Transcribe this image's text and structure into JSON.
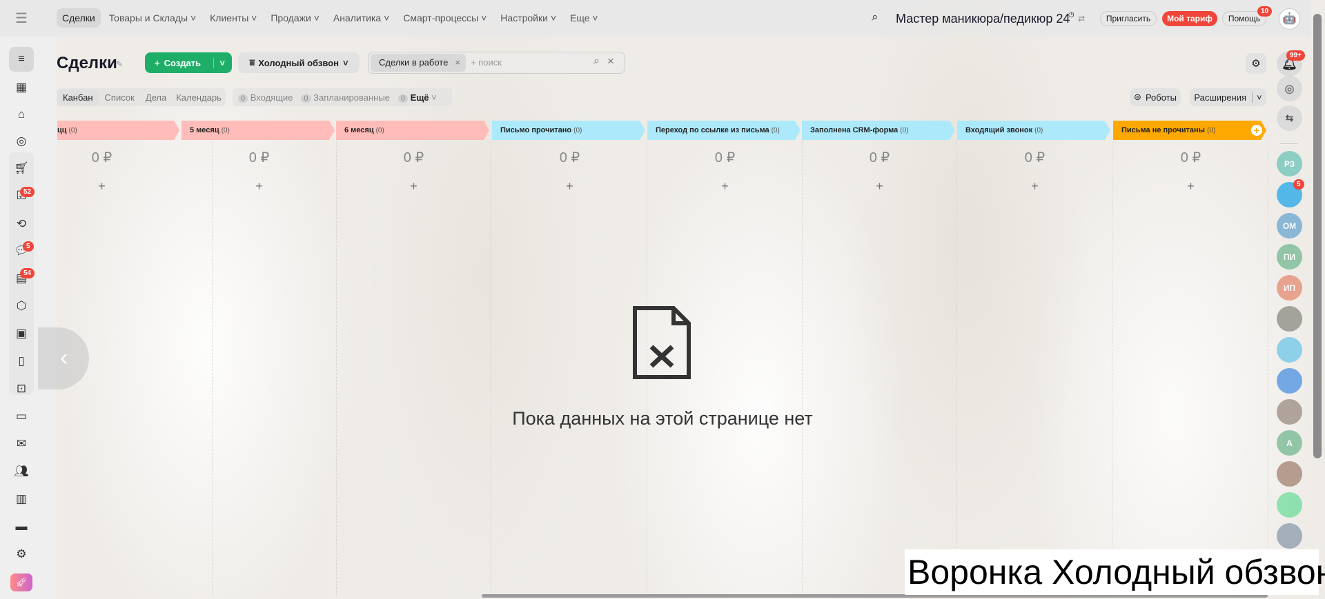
{
  "nav": {
    "items": [
      "Сделки",
      "Товары и Склады",
      "Клиенты",
      "Продажи",
      "Аналитика",
      "Смарт-процессы",
      "Настройки",
      "Еще"
    ]
  },
  "header": {
    "portal": "Мастер маникюра/педикюр 24",
    "invite": "Пригласить",
    "tariff": "Мой тариф",
    "help": "Помощь",
    "help_badge": "10"
  },
  "page": {
    "title": "Сделки",
    "create": "Создать",
    "funnel": "Холодный обзвон",
    "filter_tag": "Сделки в работе",
    "search_placeholder": "+ поиск",
    "notif_badge": "99+"
  },
  "views": {
    "tabs": [
      "Канбан",
      "Список",
      "Дела",
      "Календарь"
    ],
    "counters": [
      {
        "n": "0",
        "label": "Входящие"
      },
      {
        "n": "0",
        "label": "Запланированные"
      },
      {
        "n": "0",
        "label": "Ещё"
      }
    ],
    "robots": "Роботы",
    "extensions": "Расширения"
  },
  "sidebar_badges": {
    "tasks": "52",
    "chat": "5",
    "feed": "54"
  },
  "stages": [
    {
      "name": "цц",
      "count": "(0)",
      "sum": "0 ₽",
      "color": "#ffbcb8"
    },
    {
      "name": "5 месяц",
      "count": "(0)",
      "sum": "0 ₽",
      "color": "#ffbcb8"
    },
    {
      "name": "6 месяц",
      "count": "(0)",
      "sum": "0 ₽",
      "color": "#ffbcb8"
    },
    {
      "name": "Письмо прочитано",
      "count": "(0)",
      "sum": "0 ₽",
      "color": "#ace9fb"
    },
    {
      "name": "Переход по ссылке из письма",
      "count": "(0)",
      "sum": "0 ₽",
      "color": "#ace9fb"
    },
    {
      "name": "Заполнена CRM-форма",
      "count": "(0)",
      "sum": "0 ₽",
      "color": "#ace9fb"
    },
    {
      "name": "Входящий звонок",
      "count": "(0)",
      "sum": "0 ₽",
      "color": "#ace9fb"
    },
    {
      "name": "Письма не прочитаны",
      "count": "(0)",
      "sum": "0 ₽",
      "color": "#ffa900"
    }
  ],
  "empty": {
    "text": "Пока данных на этой странице нет"
  },
  "rail": {
    "avatars": [
      {
        "t": "РЗ",
        "c": "#6cc5b8"
      },
      {
        "t": "",
        "c": "#1fa6e8",
        "badge": "5"
      },
      {
        "t": "ОМ",
        "c": "#6aa6d0"
      },
      {
        "t": "ПИ",
        "c": "#72b890"
      },
      {
        "t": "ИП",
        "c": "#e48b70"
      },
      {
        "t": "",
        "c": "#8a8a80"
      },
      {
        "t": "",
        "c": "#6ec5e8"
      },
      {
        "t": "",
        "c": "#4a90e2"
      },
      {
        "t": "",
        "c": "#9a8a80"
      },
      {
        "t": "А",
        "c": "#72b890"
      },
      {
        "t": "",
        "c": "#a08070"
      },
      {
        "t": "",
        "c": "#6ddc9a"
      },
      {
        "t": "",
        "c": "#8a9aaa"
      }
    ]
  },
  "watermark": "Воронка Холодный обзвон"
}
